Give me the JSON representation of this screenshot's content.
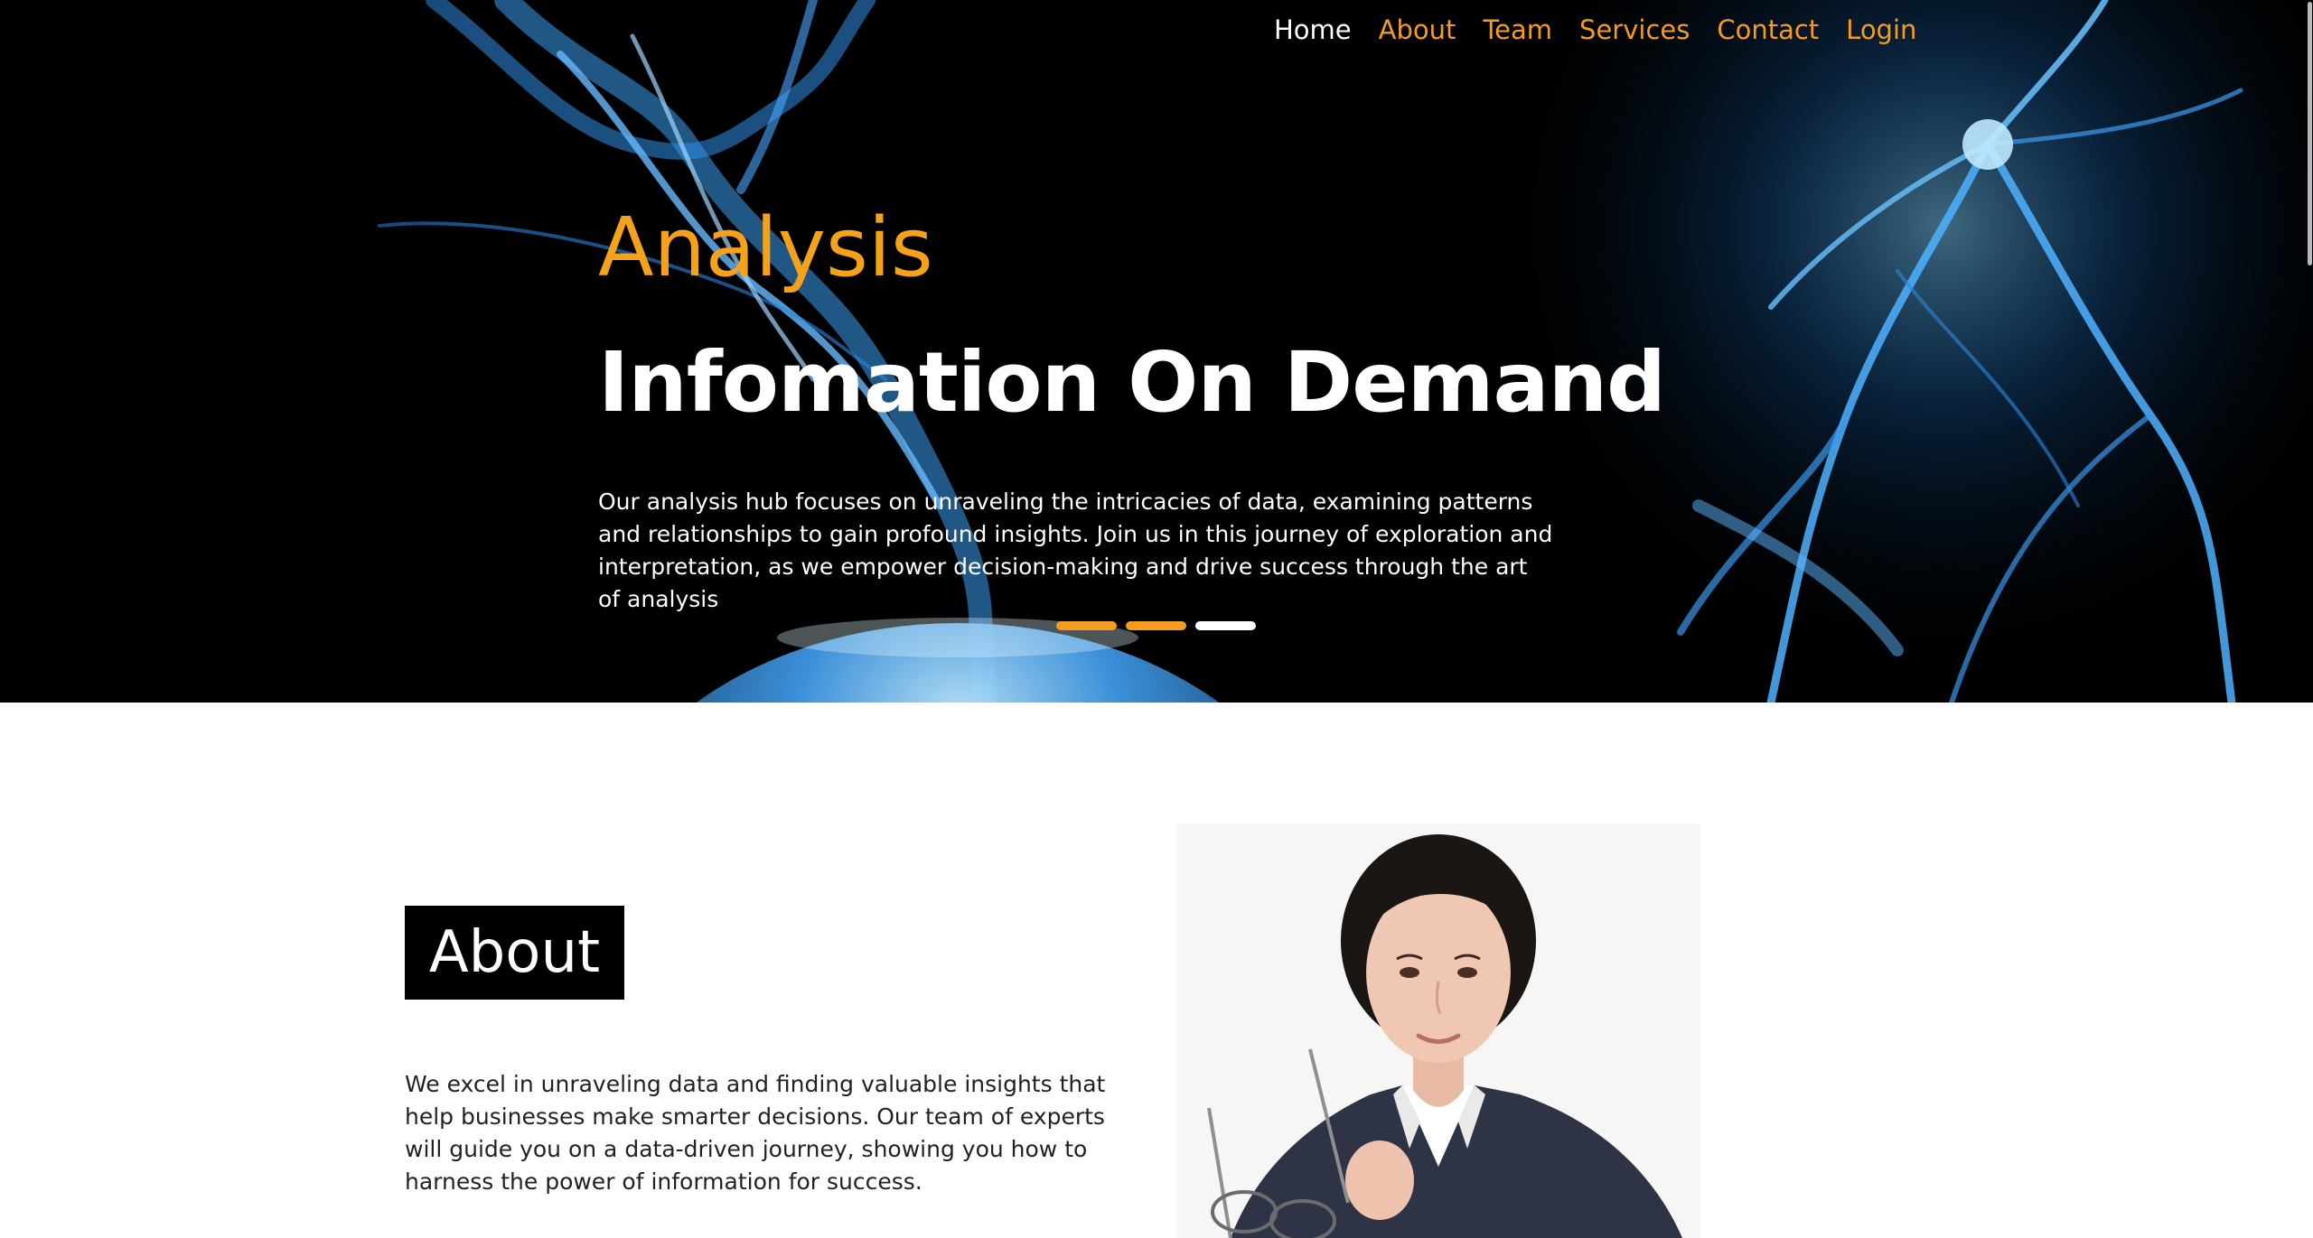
{
  "nav": {
    "items": [
      "Home",
      "About",
      "Team",
      "Services",
      "Contact",
      "Login"
    ],
    "active": "Home"
  },
  "hero": {
    "kicker": "Analysis",
    "title": "Infomation On Demand",
    "text": "Our analysis hub focuses on unraveling the intricacies of data, examining patterns and relationships to gain profound insights. Join us in this journey of exploration and interpretation, as we empower decision-making and drive success through the art of analysis",
    "slides": 3,
    "active_slide": 3
  },
  "about": {
    "heading": "About",
    "text": "We excel in unraveling data and finding valuable insights that help businesses make smarter decisions. Our team of experts will guide you on a data-driven journey, showing you how to harness the power of information for success."
  },
  "colors": {
    "accent": "#f39c1f",
    "hero_bg": "#000000",
    "plasma": "#2f8fe8",
    "heading_box": "#000000"
  },
  "icons": {
    "hero_background": "plasma-ball-image",
    "about_photo": "businesswoman-photo"
  }
}
